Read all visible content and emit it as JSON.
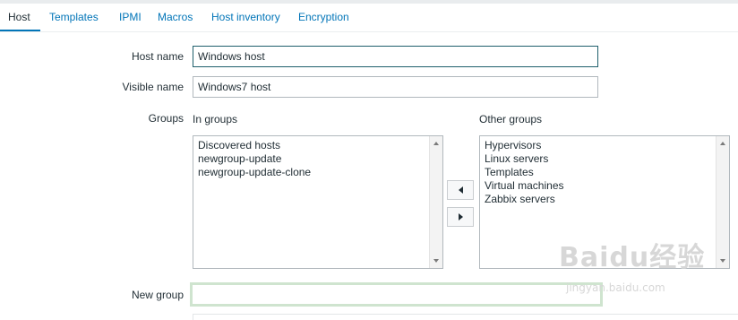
{
  "tabs": [
    "Host",
    "Templates",
    "IPMI",
    "Macros",
    "Host inventory",
    "Encryption"
  ],
  "form": {
    "host_name_label": "Host name",
    "host_name_value": "Windows host",
    "visible_name_label": "Visible name",
    "visible_name_value": "Windows7 host",
    "groups_label": "Groups",
    "in_groups_label": "In groups",
    "other_groups_label": "Other groups",
    "in_groups": [
      "Discovered hosts",
      "newgroup-update",
      "newgroup-update-clone"
    ],
    "other_groups": [
      "Hypervisors",
      "Linux servers",
      "Templates",
      "Virtual machines",
      "Zabbix servers"
    ],
    "new_group_label": "New group",
    "new_group_value": ""
  },
  "watermark": {
    "main": "Baidu经验",
    "sub": "jingyan.baidu.com"
  },
  "colors": {
    "link": "#0275b8",
    "text": "#1f2c33",
    "focus_border": "#1f5f6c",
    "new_group_border": "#cfe4cf"
  }
}
